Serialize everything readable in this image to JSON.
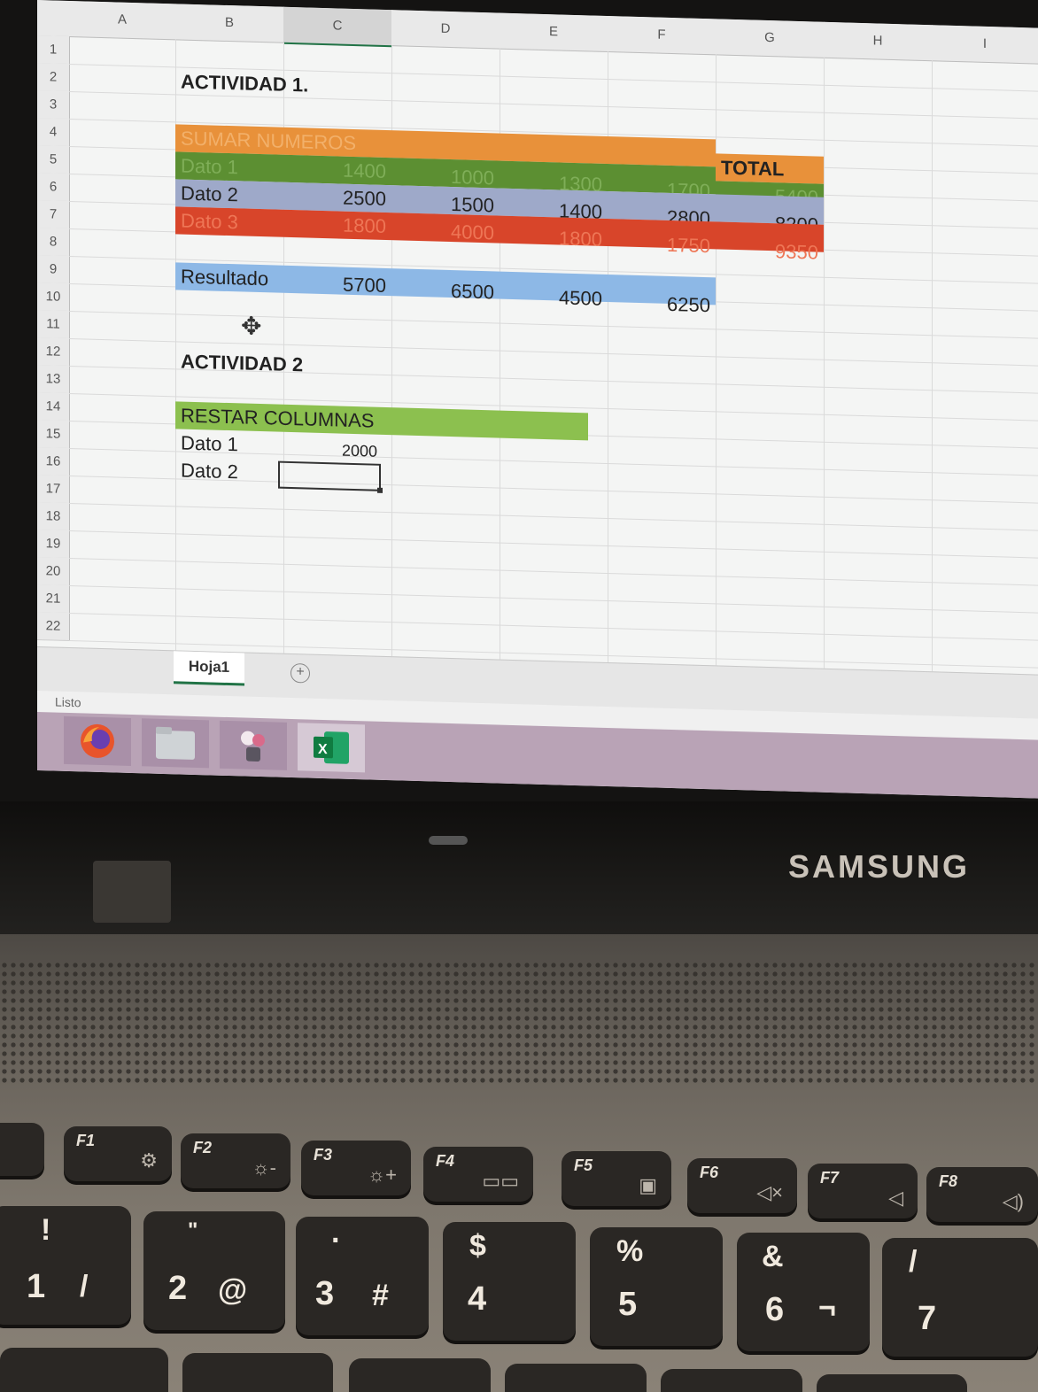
{
  "spreadsheet": {
    "columns": [
      "A",
      "B",
      "C",
      "D",
      "E",
      "F",
      "G",
      "H",
      "I"
    ],
    "rows": [
      "1",
      "2",
      "3",
      "4",
      "5",
      "6",
      "7",
      "8",
      "9",
      "10",
      "11",
      "12",
      "13",
      "14",
      "15",
      "16",
      "17",
      "18",
      "19",
      "20",
      "21",
      "22"
    ],
    "activity1_title": "ACTIVIDAD 1.",
    "sumar_header": "SUMAR NUMEROS",
    "total_header": "TOTAL",
    "dato1": {
      "label": "Dato 1",
      "values": [
        "1400",
        "1000",
        "1300",
        "1700"
      ],
      "total": "5400"
    },
    "dato2": {
      "label": "Dato 2",
      "values": [
        "2500",
        "1500",
        "1400",
        "2800"
      ],
      "total": "8200"
    },
    "dato3": {
      "label": "Dato 3",
      "values": [
        "1800",
        "4000",
        "1800",
        "1750"
      ],
      "total": "9350"
    },
    "resultado": {
      "label": "Resultado",
      "values": [
        "5700",
        "6500",
        "4500",
        "6250"
      ]
    },
    "activity2_title": "ACTIVIDAD 2",
    "restar_header": "RESTAR COLUMNAS",
    "restar_dato1": {
      "label": "Dato 1",
      "value": "2000"
    },
    "restar_dato2": {
      "label": "Dato 2"
    },
    "colors": {
      "orange": "#e8913a",
      "green": "#5c8f32",
      "blue_gray": "#9ea9c9",
      "red": "#d8452a",
      "light_blue": "#8db8e6",
      "light_green": "#8cc04f"
    }
  },
  "sheet_tab": "Hoja1",
  "add_sheet_icon": "plus-circle-icon",
  "status_text": "Listo",
  "taskbar": [
    "firefox-icon",
    "file-manager-icon",
    "image-viewer-icon",
    "excel-icon"
  ],
  "laptop_brand": "SAMSUNG",
  "keyboard": {
    "fkeys": [
      "F1",
      "F2",
      "F3",
      "F4",
      "F5",
      "F6",
      "F7",
      "F8"
    ],
    "numkeys": [
      {
        "top": "!",
        "bottom": "1",
        "alt": "/"
      },
      {
        "top": "\"",
        "bottom": "2",
        "alt": "@"
      },
      {
        "top": "·",
        "bottom": "3",
        "alt": "#"
      },
      {
        "top": "$",
        "bottom": "4",
        "alt": ""
      },
      {
        "top": "%",
        "bottom": "5",
        "alt": ""
      },
      {
        "top": "&",
        "bottom": "6",
        "alt": "¬"
      },
      {
        "top": "/",
        "bottom": "7",
        "alt": ""
      }
    ]
  }
}
